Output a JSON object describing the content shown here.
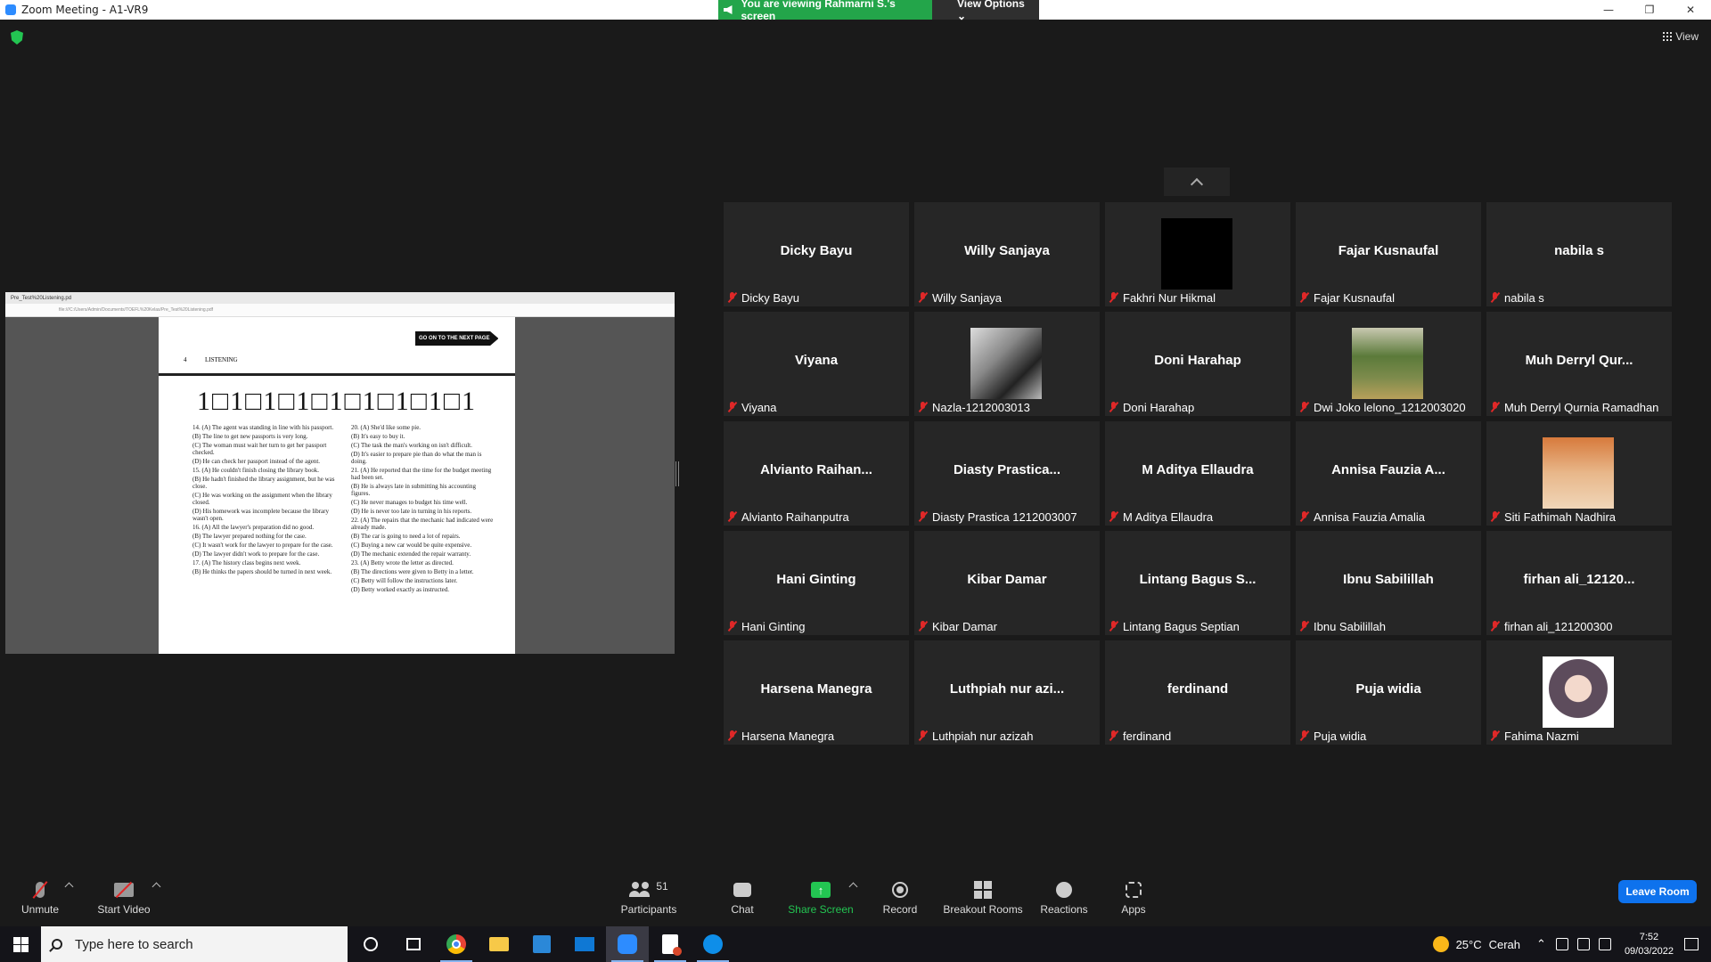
{
  "window": {
    "title": "Zoom Meeting - A1-VR9",
    "controls": {
      "minimize": "—",
      "restore": "❐",
      "close": "✕"
    }
  },
  "banner": {
    "viewing_text": "You are viewing Rahmarni S.'s screen",
    "view_options_label": "View Options ⌄"
  },
  "view_button": {
    "label": "View"
  },
  "shared_screen": {
    "tab_title": "Pre_Test%20Listening.pd",
    "address": "file:///C:/Users/Admin/Documents/TOEFL%20Kelas/Pre_Test%20Listening.pdf",
    "page": {
      "number": "4",
      "section": "LISTENING",
      "go_next_label": "GO ON TO THE NEXT PAGE",
      "big_row": "1□1□1□1□1□1□1□1□1",
      "left_column": [
        "14. (A) The agent was standing in line with his passport.",
        "(B) The line to get new passports is very long.",
        "(C) The woman must wait her turn to get her passport checked.",
        "(D) He can check her passport instead of the agent.",
        "15. (A) He couldn't finish closing the library book.",
        "(B) He hadn't finished the library assignment, but he was close.",
        "(C) He was working on the assignment when the library closed.",
        "(D) His homework was incomplete because the library wasn't open.",
        "16. (A) All the lawyer's preparation did no good.",
        "(B) The lawyer prepared nothing for the case.",
        "(C) It wasn't work for the lawyer to prepare for the case.",
        "(D) The lawyer didn't work to prepare for the case.",
        "17. (A) The history class begins next week.",
        "(B) He thinks the papers should be turned in next week."
      ],
      "right_column": [
        "20. (A) She'd like some pie.",
        "(B) It's easy to buy it.",
        "(C) The task the man's working on isn't difficult.",
        "(D) It's easier to prepare pie than do what the man is doing.",
        "21. (A) He reported that the time for the budget meeting had been set.",
        "(B) He is always late in submitting his accounting figures.",
        "(C) He never manages to budget his time well.",
        "(D) He is never too late in turning in his reports.",
        "22. (A) The repairs that the mechanic had indicated were already made.",
        "(B) The car is going to need a lot of repairs.",
        "(C) Buying a new car would be quite expensive.",
        "(D) The mechanic extended the repair warranty.",
        "23. (A) Betty wrote the letter as directed.",
        "(B) The directions were given to Betty in a letter.",
        "(C) Betty will follow the instructions later.",
        "(D) Betty worked exactly as instructed."
      ]
    }
  },
  "participants": [
    {
      "display": "Dicky Bayu",
      "label": "Dicky Bayu",
      "photo": ""
    },
    {
      "display": "Willy Sanjaya",
      "label": "Willy Sanjaya",
      "photo": ""
    },
    {
      "display": "",
      "label": "Fakhri Nur Hikmal",
      "photo": "black"
    },
    {
      "display": "Fajar Kusnaufal",
      "label": "Fajar Kusnaufal",
      "photo": ""
    },
    {
      "display": "nabila s",
      "label": "nabila s",
      "photo": ""
    },
    {
      "display": "Viyana",
      "label": "Viyana",
      "photo": ""
    },
    {
      "display": "",
      "label": "Nazla-1212003013",
      "photo": "face"
    },
    {
      "display": "Doni Harahap",
      "label": "Doni Harahap",
      "photo": ""
    },
    {
      "display": "",
      "label": "Dwi Joko lelono_1212003020",
      "photo": "field"
    },
    {
      "display": "Muh Derryl Qur...",
      "label": "Muh Derryl Qurnia Ramadhan",
      "photo": ""
    },
    {
      "display": "Alvianto  Raihan...",
      "label": "Alvianto Raihanputra",
      "photo": ""
    },
    {
      "display": "Diasty  Prastica...",
      "label": "Diasty Prastica 1212003007",
      "photo": ""
    },
    {
      "display": "M Aditya Ellaudra",
      "label": "M Aditya Ellaudra",
      "photo": ""
    },
    {
      "display": "Annisa Fauzia A...",
      "label": "Annisa Fauzia Amalia",
      "photo": ""
    },
    {
      "display": "",
      "label": "Siti Fathimah Nadhira",
      "photo": "anime"
    },
    {
      "display": "Hani Ginting",
      "label": "Hani Ginting",
      "photo": ""
    },
    {
      "display": "Kibar Damar",
      "label": "Kibar Damar",
      "photo": ""
    },
    {
      "display": "Lintang Bagus S...",
      "label": "Lintang Bagus Septian",
      "photo": ""
    },
    {
      "display": "Ibnu Sabilillah",
      "label": "Ibnu Sabilillah",
      "photo": ""
    },
    {
      "display": "firhan ali_12120...",
      "label": "firhan ali_121200300",
      "photo": ""
    },
    {
      "display": "Harsena Manegra",
      "label": "Harsena Manegra",
      "photo": ""
    },
    {
      "display": "Luthpiah  nur azi...",
      "label": "Luthpiah nur azizah",
      "photo": ""
    },
    {
      "display": "ferdinand",
      "label": "ferdinand",
      "photo": ""
    },
    {
      "display": "Puja widia",
      "label": "Puja widia",
      "photo": ""
    },
    {
      "display": "",
      "label": "Fahima Nazmi",
      "photo": "hijab"
    }
  ],
  "toolbar": {
    "unmute": "Unmute",
    "start_video": "Start Video",
    "participants": "Participants",
    "participants_count": "51",
    "chat": "Chat",
    "share_screen": "Share Screen",
    "record": "Record",
    "breakout_rooms": "Breakout Rooms",
    "reactions": "Reactions",
    "apps": "Apps",
    "leave": "Leave Room"
  },
  "taskbar": {
    "search_placeholder": "Type here to search",
    "weather_temp": "25°C",
    "weather_text": "Cerah",
    "time": "7:52",
    "date": "09/03/2022"
  },
  "colors": {
    "accent_green": "#23a54a",
    "leave_blue": "#0e72ed",
    "muted_red": "#e02828"
  }
}
